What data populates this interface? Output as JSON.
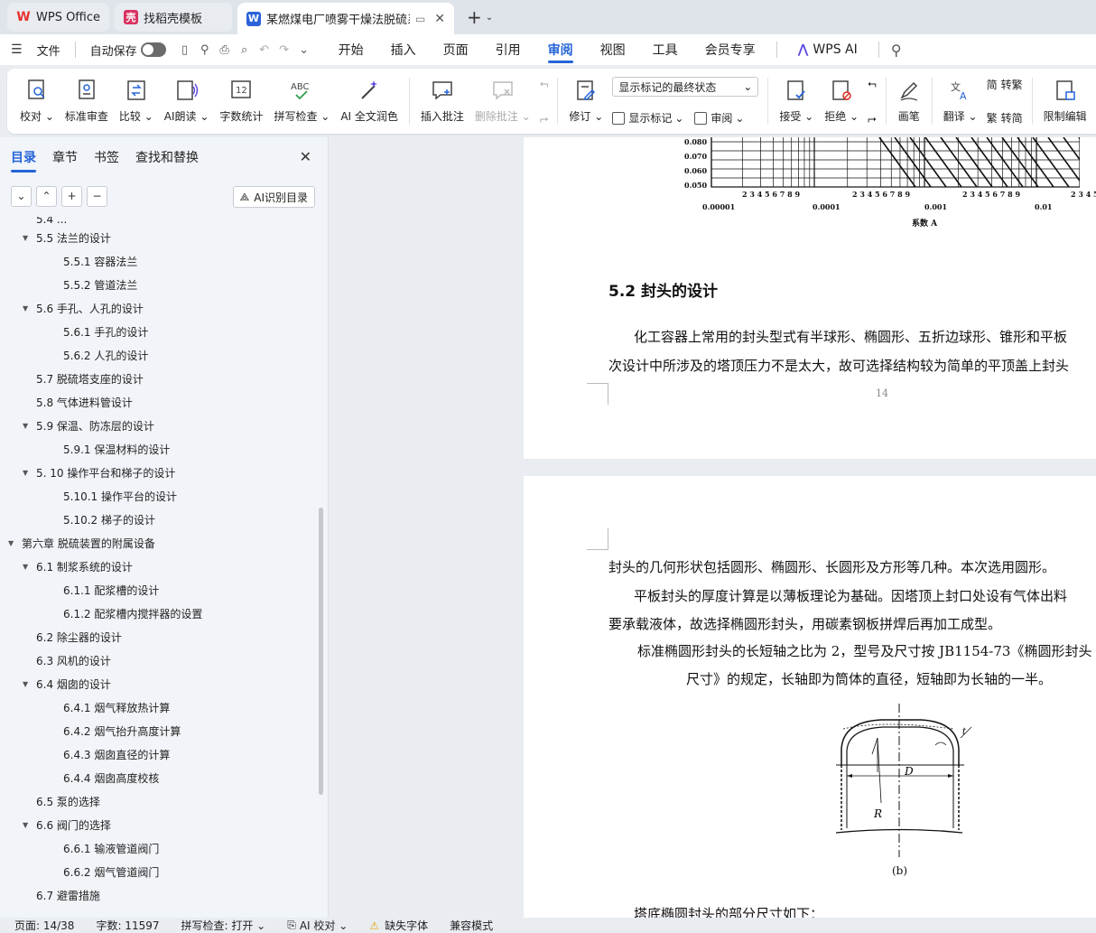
{
  "tabs": [
    {
      "label": "WPS Office",
      "icon": "wps-logo-icon",
      "color": "#e8322f"
    },
    {
      "label": "找稻壳模板",
      "icon": "docer-logo-icon",
      "color": "#d9325f"
    },
    {
      "label": "某燃煤电厂喷雾干燥法脱硫系",
      "icon": "word-doc-icon",
      "color": "#2b62d9"
    }
  ],
  "menu": {
    "file": "文件",
    "autosave": "自动保存",
    "tabs": [
      "开始",
      "插入",
      "页面",
      "引用",
      "审阅",
      "视图",
      "工具",
      "会员专享"
    ],
    "active_tab": "审阅",
    "wps_ai": "WPS AI"
  },
  "ribbon": {
    "proofread": "校对",
    "std_review": "标准审查",
    "compare": "比较",
    "ai_read": "AI朗读",
    "word_count": "字数统计",
    "spell_check": "拼写检查",
    "ai_polish": "AI 全文润色",
    "insert_comment": "插入批注",
    "delete_comment": "删除批注",
    "revise": "修订",
    "markup_select": "显示标记的最终状态",
    "show_markup": "显示标记",
    "review": "审阅",
    "accept": "接受",
    "reject": "拒绝",
    "pen": "画笔",
    "translate": "翻译",
    "to_traditional": "转繁",
    "to_simplified": "转简",
    "restrict_edit": "限制编辑"
  },
  "nav": {
    "tabs": [
      "目录",
      "章节",
      "书签",
      "查找和替换"
    ],
    "ai_toc": "AI识别目录",
    "items": [
      {
        "label": "5.4 ...",
        "level": 2,
        "arrow": false,
        "partial": true
      },
      {
        "label": "5.5 法兰的设计",
        "level": 2,
        "arrow": true
      },
      {
        "label": "5.5.1 容器法兰",
        "level": 3,
        "arrow": false
      },
      {
        "label": "5.5.2 管道法兰",
        "level": 3,
        "arrow": false
      },
      {
        "label": "5.6 手孔、人孔的设计",
        "level": 2,
        "arrow": true
      },
      {
        "label": "5.6.1  手孔的设计",
        "level": 3,
        "arrow": false
      },
      {
        "label": "5.6.2  人孔的设计",
        "level": 3,
        "arrow": false
      },
      {
        "label": "5.7 脱硫塔支座的设计",
        "level": 2,
        "arrow": false
      },
      {
        "label": "5.8 气体进料管设计",
        "level": 2,
        "arrow": false
      },
      {
        "label": "5.9 保温、防冻层的设计",
        "level": 2,
        "arrow": true
      },
      {
        "label": "5.9.1  保温材料的设计",
        "level": 3,
        "arrow": false
      },
      {
        "label": "5. 10  操作平台和梯子的设计",
        "level": 2,
        "arrow": true
      },
      {
        "label": "5.10.1  操作平台的设计",
        "level": 3,
        "arrow": false
      },
      {
        "label": "5.10.2  梯子的设计",
        "level": 3,
        "arrow": false
      },
      {
        "label": "第六章  脱硫装置的附属设备",
        "level": 1,
        "arrow": true
      },
      {
        "label": "6.1 制浆系统的设计",
        "level": 2,
        "arrow": true
      },
      {
        "label": "6.1.1 配浆槽的设计",
        "level": 3,
        "arrow": false
      },
      {
        "label": "6.1.2 配浆槽内搅拌器的设置",
        "level": 3,
        "arrow": false
      },
      {
        "label": "6.2 除尘器的设计",
        "level": 2,
        "arrow": false
      },
      {
        "label": "6.3 风机的设计",
        "level": 2,
        "arrow": false
      },
      {
        "label": "6.4 烟囱的设计",
        "level": 2,
        "arrow": true
      },
      {
        "label": "6.4.1 烟气释放热计算",
        "level": 3,
        "arrow": false
      },
      {
        "label": "6.4.2 烟气抬升高度计算",
        "level": 3,
        "arrow": false
      },
      {
        "label": "6.4.3 烟囱直径的计算",
        "level": 3,
        "arrow": false
      },
      {
        "label": "6.4.4 烟囱高度校核",
        "level": 3,
        "arrow": false
      },
      {
        "label": "6.5 泵的选择",
        "level": 2,
        "arrow": false
      },
      {
        "label": "6.6  阀门的选择",
        "level": 2,
        "arrow": true
      },
      {
        "label": "6.6.1  输液管道阀门",
        "level": 3,
        "arrow": false
      },
      {
        "label": "6.6.2   烟气管道阀门",
        "level": 3,
        "arrow": false
      },
      {
        "label": "6.7  避雷措施",
        "level": 2,
        "arrow": false
      }
    ]
  },
  "doc": {
    "chart_yticks": [
      "0.080",
      "0.070",
      "0.060",
      "0.050"
    ],
    "chart_xticks": [
      "0.00001",
      "0.0001",
      "0.001",
      "0.01"
    ],
    "chart_minor": "2  3  4 5 6 7 8 9",
    "chart_xlabel": "系数 A",
    "heading": "5.2  封头的设计",
    "p1_line1": "化工容器上常用的封头型式有半球形、椭圆形、五折边球形、锥形和平板",
    "p1_line2": "次设计中所涉及的塔顶压力不是太大，故可选择结构较为简单的平顶盖上封头",
    "page_number": "14",
    "p2_line1": "封头的几何形状包括圆形、椭圆形、长圆形及方形等几种。本次选用圆形。",
    "p3_line1": "平板封头的厚度计算是以薄板理论为基础。因塔顶上封口处设有气体出料",
    "p3_line2": "要承载液体，故选择椭圆形封头，用碳素钢板拼焊后再加工成型。",
    "p4_line1": "标准椭圆形封头的长短轴之比为 2，型号及尺寸按 JB1154-73《椭圆形封头",
    "p4_line2": "尺寸》的规定，长轴即为筒体的直径，短轴即为长轴的一半。",
    "fig_label_di": "D",
    "fig_label_r": "R",
    "fig_label_t": "t",
    "fig_caption": "(b)",
    "p5_line1": "塔底椭圆封头的部分尺寸如下："
  },
  "status": {
    "page": "页面: 14/38",
    "words": "字数: 11597",
    "spell": "拼写检查: 打开",
    "ai_proof": "AI 校对",
    "missing_font": "缺失字体",
    "compat": "兼容模式"
  }
}
